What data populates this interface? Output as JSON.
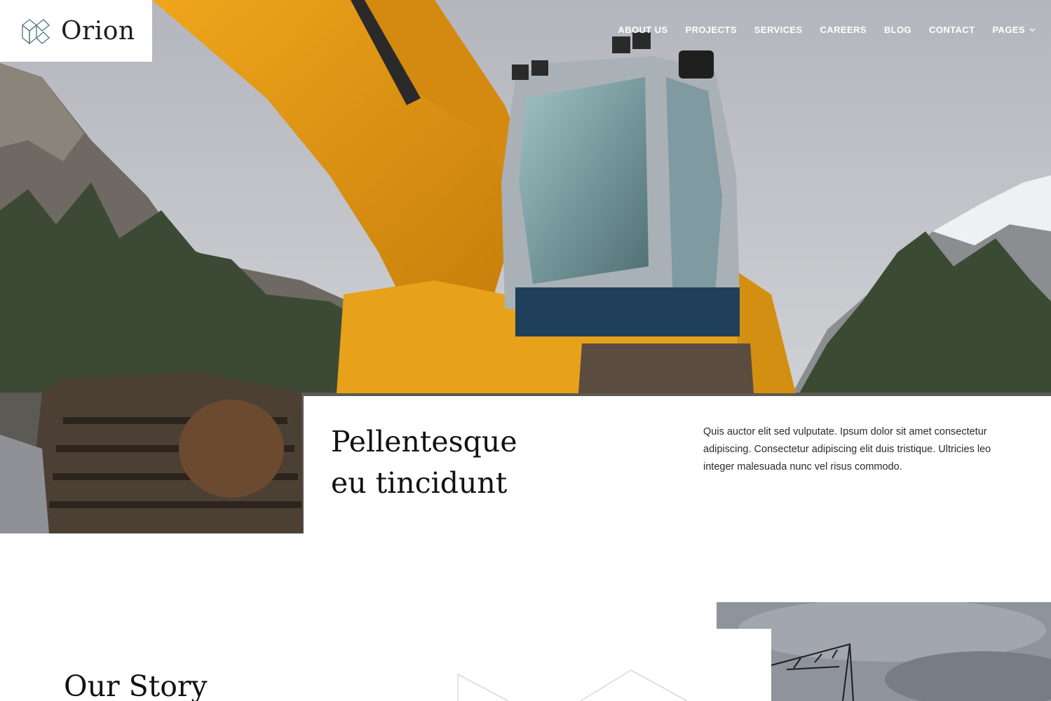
{
  "brand": {
    "name": "Orion"
  },
  "nav": {
    "items": [
      {
        "label": "ABOUT US"
      },
      {
        "label": "PROJECTS"
      },
      {
        "label": "SERVICES"
      },
      {
        "label": "CAREERS"
      },
      {
        "label": "BLOG"
      },
      {
        "label": "CONTACT"
      },
      {
        "label": "PAGES",
        "has_dropdown": true
      }
    ]
  },
  "hero": {
    "image": "excavator-photo",
    "heading": "Pellentesque eu tincidunt",
    "heading_line1": "Pellentesque",
    "heading_line2": "eu tincidunt",
    "text": "Quis auctor elit sed vulputate. Ipsum dolor sit amet consectetur adipiscing. Consectetur adipiscing elit duis tristique. Ultricies leo integer malesuada nunc vel risus commodo."
  },
  "story": {
    "title": "Our Story",
    "image": "crane-photo"
  },
  "colors": {
    "nav_text": "#ffffff",
    "heading": "#111111",
    "body_text": "#2a2a2a",
    "excavator_yellow": "#e8a11a",
    "sky": "#c9cbd0"
  }
}
